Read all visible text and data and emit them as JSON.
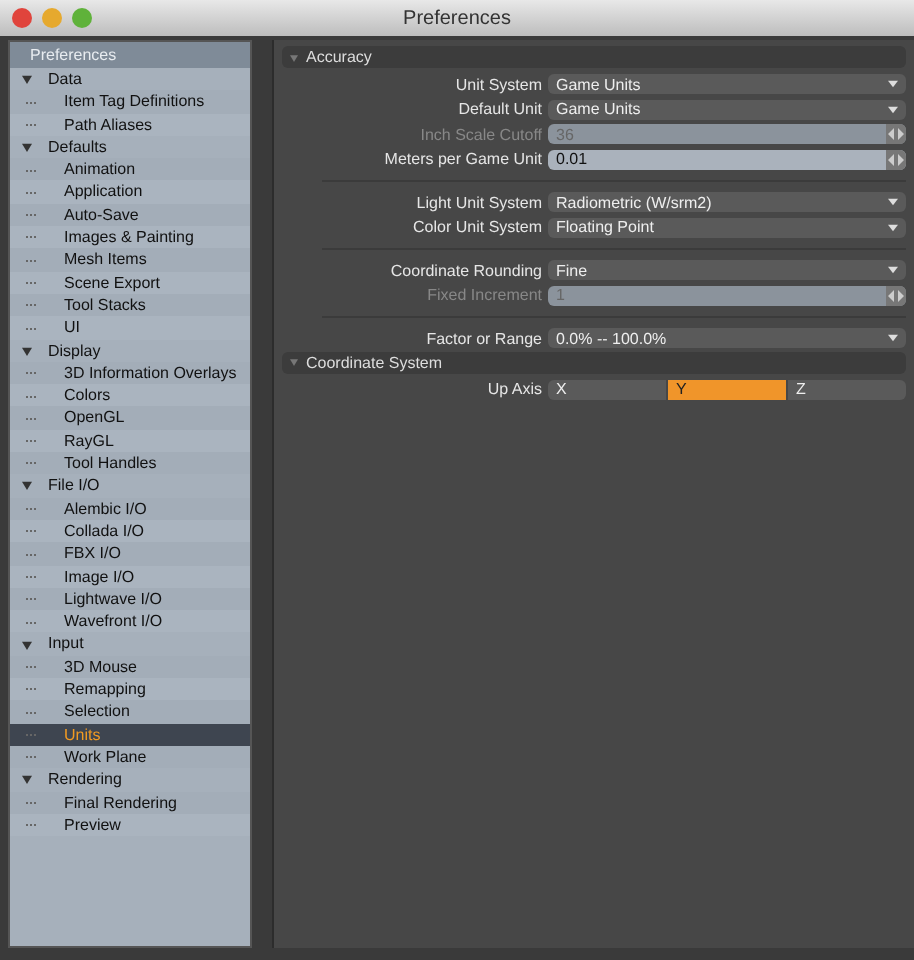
{
  "window": {
    "title": "Preferences"
  },
  "sidebar": {
    "title": "Preferences",
    "groups": [
      {
        "label": "Data",
        "expanded": true,
        "children": [
          {
            "label": "Item Tag Definitions",
            "selected": false
          },
          {
            "label": "Path Aliases",
            "selected": false
          }
        ]
      },
      {
        "label": "Defaults",
        "expanded": true,
        "children": [
          {
            "label": "Animation",
            "selected": false
          },
          {
            "label": "Application",
            "selected": false
          },
          {
            "label": "Auto-Save",
            "selected": false
          },
          {
            "label": "Images & Painting",
            "selected": false
          },
          {
            "label": "Mesh Items",
            "selected": false
          },
          {
            "label": "Scene Export",
            "selected": false
          },
          {
            "label": "Tool Stacks",
            "selected": false
          },
          {
            "label": "UI",
            "selected": false
          }
        ]
      },
      {
        "label": "Display",
        "expanded": true,
        "children": [
          {
            "label": "3D Information Overlays",
            "selected": false
          },
          {
            "label": "Colors",
            "selected": false
          },
          {
            "label": "OpenGL",
            "selected": false
          },
          {
            "label": "RayGL",
            "selected": false
          },
          {
            "label": "Tool Handles",
            "selected": false
          }
        ]
      },
      {
        "label": "File I/O",
        "expanded": true,
        "children": [
          {
            "label": "Alembic I/O",
            "selected": false
          },
          {
            "label": "Collada I/O",
            "selected": false
          },
          {
            "label": "FBX I/O",
            "selected": false
          },
          {
            "label": "Image I/O",
            "selected": false
          },
          {
            "label": "Lightwave I/O",
            "selected": false
          },
          {
            "label": "Wavefront I/O",
            "selected": false
          }
        ]
      },
      {
        "label": "Input",
        "expanded": true,
        "children": [
          {
            "label": "3D Mouse",
            "selected": false
          },
          {
            "label": "Remapping",
            "selected": false
          },
          {
            "label": "Selection",
            "selected": false
          },
          {
            "label": "Units",
            "selected": true
          },
          {
            "label": "Work Plane",
            "selected": false
          }
        ]
      },
      {
        "label": "Rendering",
        "expanded": true,
        "children": [
          {
            "label": "Final Rendering",
            "selected": false
          },
          {
            "label": "Preview",
            "selected": false
          }
        ]
      }
    ]
  },
  "sections": [
    {
      "title": "Accuracy",
      "expanded": true,
      "rows": [
        {
          "kind": "dropdown",
          "label": "Unit System",
          "value": "Game Units",
          "disabled": false
        },
        {
          "kind": "dropdown",
          "label": "Default Unit",
          "value": "Game Units",
          "disabled": false
        },
        {
          "kind": "number",
          "label": "Inch Scale Cutoff",
          "value": "36",
          "disabled": true
        },
        {
          "kind": "number",
          "label": "Meters per Game Unit",
          "value": "0.01",
          "disabled": false
        },
        {
          "kind": "divider"
        },
        {
          "kind": "dropdown",
          "label": "Light Unit System",
          "value": "Radiometric (W/srm2)",
          "disabled": false
        },
        {
          "kind": "dropdown",
          "label": "Color Unit System",
          "value": "Floating Point",
          "disabled": false
        },
        {
          "kind": "divider"
        },
        {
          "kind": "dropdown",
          "label": "Coordinate Rounding",
          "value": "Fine",
          "disabled": false
        },
        {
          "kind": "number",
          "label": "Fixed Increment",
          "value": "1",
          "disabled": true
        },
        {
          "kind": "divider"
        },
        {
          "kind": "dropdown",
          "label": "Factor or Range",
          "value": "0.0% -- 100.0%",
          "disabled": false
        }
      ]
    },
    {
      "title": "Coordinate System",
      "expanded": true,
      "rows": [
        {
          "kind": "segmented",
          "label": "Up Axis",
          "options": [
            {
              "label": "X",
              "selected": false
            },
            {
              "label": "Y",
              "selected": true
            },
            {
              "label": "Z",
              "selected": false
            }
          ]
        }
      ]
    }
  ]
}
